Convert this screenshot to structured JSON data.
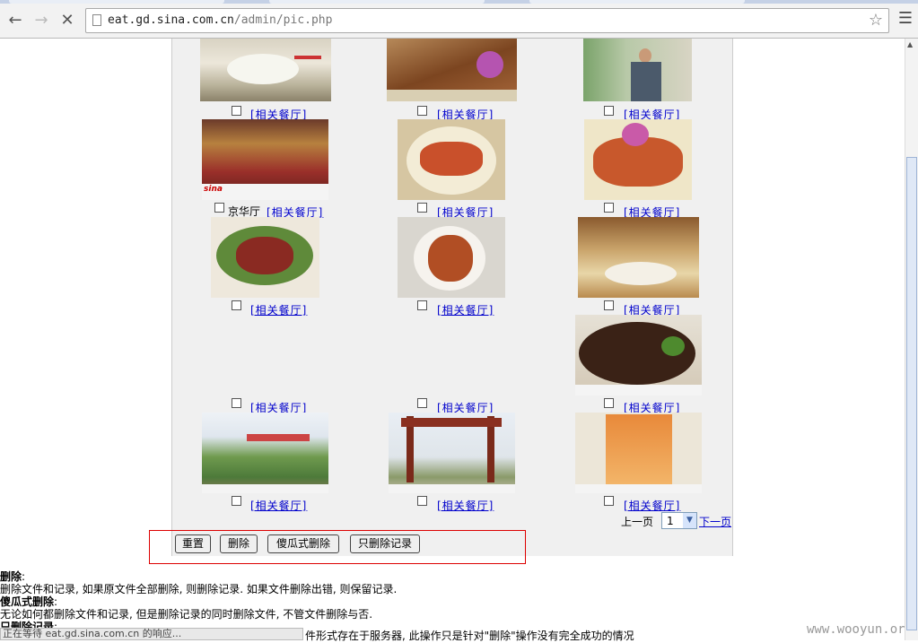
{
  "browser": {
    "url_host": "eat.gd.sina.com.cn",
    "url_path": "/admin/pic.php",
    "menu_icon": "hamburger-menu-icon"
  },
  "gallery": {
    "link_label": "[相关餐厅]",
    "caption_jinghua": "京华厅",
    "photo_credit": "sina"
  },
  "pager": {
    "prev_label": "上一页",
    "page_value": "1",
    "next_label": "下一页"
  },
  "buttons": {
    "reset": "重置",
    "delete": "删除",
    "force_delete": "傻瓜式删除",
    "delete_record_only": "只删除记录"
  },
  "help": {
    "delete_title": "删除",
    "delete_desc": "删除文件和记录, 如果原文件全部删除, 则删除记录. 如果文件删除出错, 则保留记录.",
    "force_title": "傻瓜式删除",
    "force_desc": "无论如何都删除文件和记录, 但是删除记录的同时删除文件, 不管文件删除与否.",
    "record_title": "只删除记录",
    "record_tail": "件形式存在于服务器, 此操作只是针对\"删除\"操作没有完全成功的情况"
  },
  "status": {
    "text": "正在等待 eat.gd.sina.com.cn 的响应..."
  },
  "watermark": "www.wooyun.org",
  "colors": {
    "link": "#0000cc",
    "panel_bg": "#f0f0f0",
    "highlight_border": "#dd0000"
  }
}
